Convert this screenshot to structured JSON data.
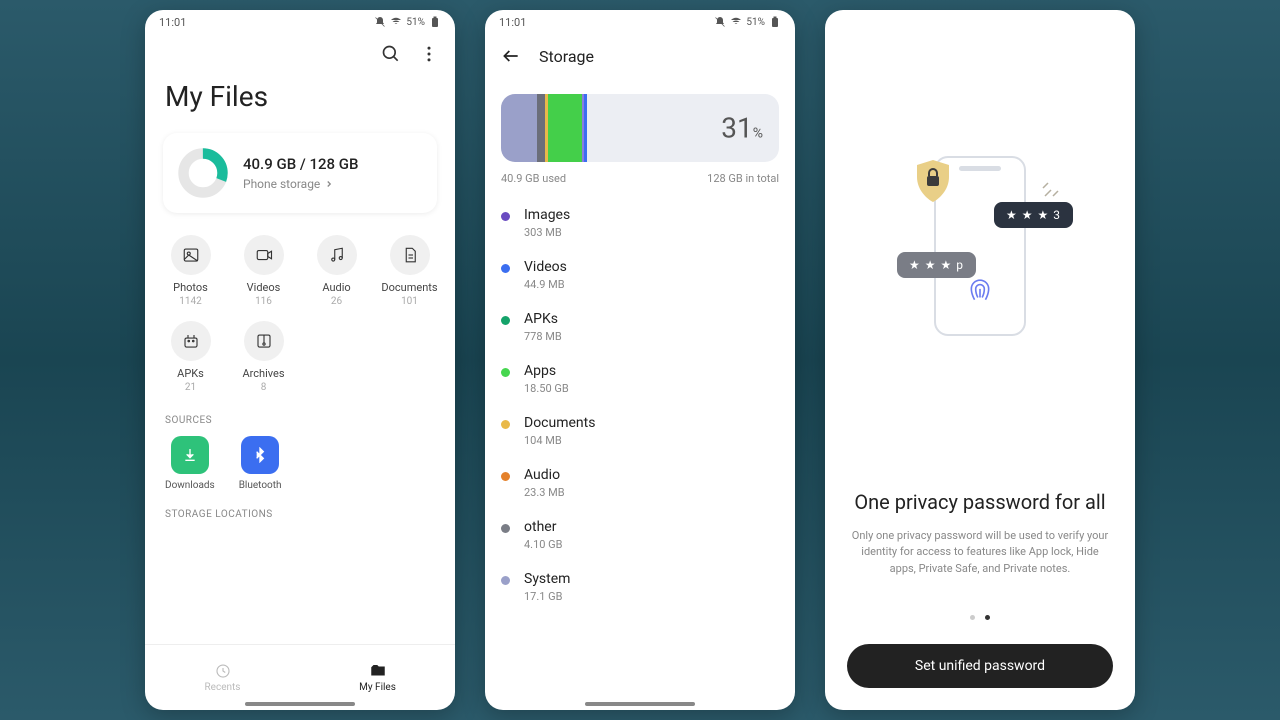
{
  "statusbar": {
    "time": "11:01",
    "battery": "51%"
  },
  "phone1": {
    "title": "My Files",
    "storage_used": "40.9 GB / 128 GB",
    "storage_label": "Phone storage",
    "categories": [
      {
        "name": "Photos",
        "count": "1142",
        "icon": "image"
      },
      {
        "name": "Videos",
        "count": "116",
        "icon": "video"
      },
      {
        "name": "Audio",
        "count": "26",
        "icon": "music"
      },
      {
        "name": "Documents",
        "count": "101",
        "icon": "doc"
      },
      {
        "name": "APKs",
        "count": "21",
        "icon": "apk"
      },
      {
        "name": "Archives",
        "count": "8",
        "icon": "archive"
      }
    ],
    "sources_label": "SOURCES",
    "sources": [
      {
        "name": "Downloads",
        "color": "green",
        "icon": "download"
      },
      {
        "name": "Bluetooth",
        "color": "blue",
        "icon": "bluetooth"
      }
    ],
    "storage_locations_label": "STORAGE LOCATIONS",
    "nav": {
      "recents": "Recents",
      "myfiles": "My Files"
    }
  },
  "phone2": {
    "title": "Storage",
    "pct": "31",
    "pct_sym": "%",
    "used": "40.9 GB used",
    "total": "128 GB in total",
    "segments": [
      {
        "color": "#9aa0c9",
        "width": 13
      },
      {
        "color": "#6b6e7a",
        "width": 3
      },
      {
        "color": "#e9b949",
        "width": 1
      },
      {
        "color": "#44cf4a",
        "width": 12
      },
      {
        "color": "#8a7de0",
        "width": 1
      },
      {
        "color": "#3b6ef0",
        "width": 1
      }
    ],
    "breakdown": [
      {
        "name": "Images",
        "size": "303 MB",
        "color": "#6a4cc1"
      },
      {
        "name": "Videos",
        "size": "44.9 MB",
        "color": "#3b6ef0"
      },
      {
        "name": "APKs",
        "size": "778 MB",
        "color": "#15a36a"
      },
      {
        "name": "Apps",
        "size": "18.50  GB",
        "color": "#46d64f"
      },
      {
        "name": "Documents",
        "size": "104 MB",
        "color": "#e9b949"
      },
      {
        "name": "Audio",
        "size": "23.3 MB",
        "color": "#e4812b"
      },
      {
        "name": "other",
        "size": "4.10 GB",
        "color": "#7a7d86"
      },
      {
        "name": "System",
        "size": "17.1 GB",
        "color": "#9aa0c9"
      }
    ]
  },
  "phone3": {
    "bubble1": "★ ★ ★ 3",
    "bubble2": "★ ★ ★ p",
    "title": "One privacy password for all",
    "desc": "Only one privacy password will be used to verify your identity for access to features like App lock, Hide apps, Private Safe, and Private notes.",
    "cta": "Set unified password"
  }
}
